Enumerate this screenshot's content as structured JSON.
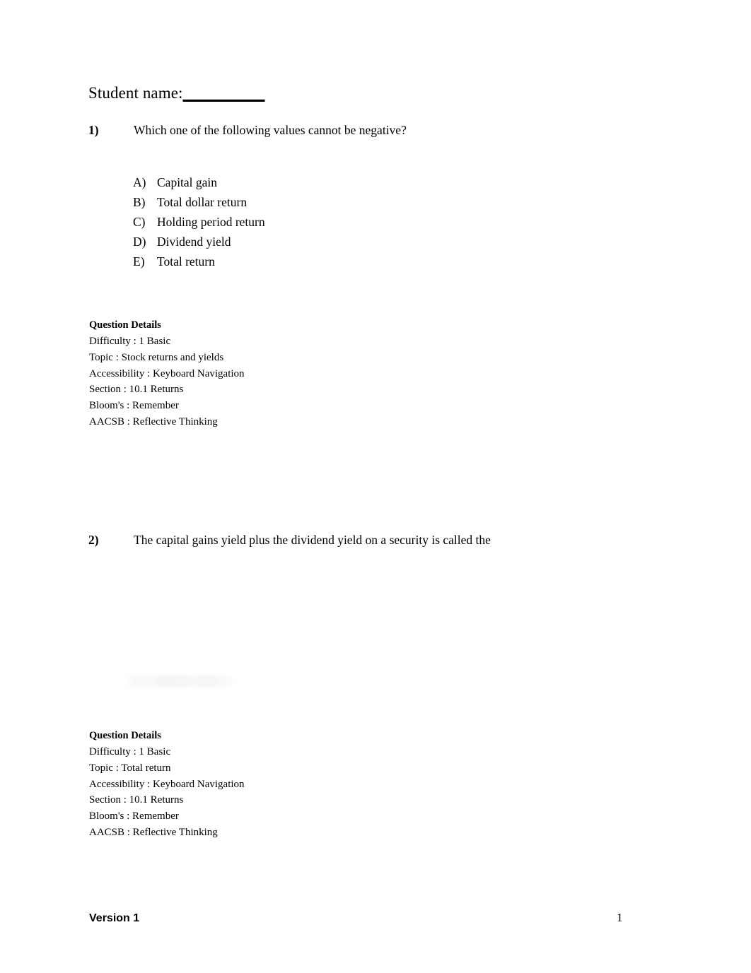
{
  "document": {
    "heading": {
      "label": "Student name:",
      "blank": "__________"
    },
    "questions": [
      {
        "number": "1)",
        "text": "Which one of the following values cannot be negative?",
        "options": [
          {
            "label": "A)",
            "text": "Capital gain"
          },
          {
            "label": "B)",
            "text": "Total dollar return"
          },
          {
            "label": "C)",
            "text": "Holding period return"
          },
          {
            "label": "D)",
            "text": "Dividend yield"
          },
          {
            "label": "E)",
            "text": "Total return"
          }
        ],
        "details": {
          "title": "Question Details",
          "lines": [
            "Difficulty : 1 Basic",
            "Topic : Stock returns and yields",
            "Accessibility : Keyboard Navigation",
            "Section : 10.1 Returns",
            "Bloom's : Remember",
            "AACSB : Reflective Thinking"
          ]
        }
      },
      {
        "number": "2)",
        "text": "The capital gains yield plus the dividend yield on a security is called the",
        "details": {
          "title": "Question Details",
          "lines": [
            "Difficulty : 1 Basic",
            "Topic : Total return",
            "Accessibility : Keyboard Navigation",
            "Section : 10.1 Returns",
            "Bloom's : Remember",
            "AACSB : Reflective Thinking"
          ]
        }
      }
    ],
    "footer": {
      "version": "Version 1",
      "page_number": "1"
    }
  }
}
